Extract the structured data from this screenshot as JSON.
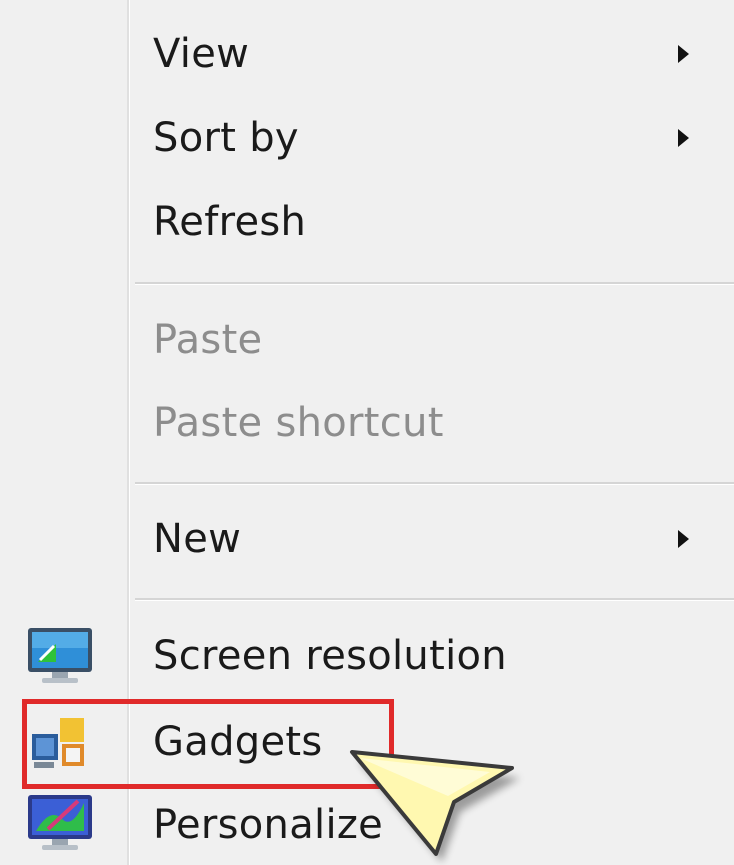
{
  "context_menu": {
    "items": [
      {
        "label": "View",
        "has_submenu": true,
        "enabled": true
      },
      {
        "label": "Sort by",
        "has_submenu": true,
        "enabled": true
      },
      {
        "label": "Refresh",
        "has_submenu": false,
        "enabled": true
      },
      {
        "label": "Paste",
        "has_submenu": false,
        "enabled": false
      },
      {
        "label": "Paste shortcut",
        "has_submenu": false,
        "enabled": false
      },
      {
        "label": "New",
        "has_submenu": true,
        "enabled": true
      },
      {
        "label": "Screen resolution",
        "has_submenu": false,
        "enabled": true,
        "icon": "screen-resolution-icon"
      },
      {
        "label": "Gadgets",
        "has_submenu": false,
        "enabled": true,
        "icon": "gadgets-icon",
        "highlighted": true
      },
      {
        "label": "Personalize",
        "has_submenu": false,
        "enabled": true,
        "icon": "personalize-icon"
      }
    ]
  },
  "colors": {
    "menu_background": "#f0f0f0",
    "text": "#1a1a1a",
    "disabled_text": "#8d8d8d",
    "highlight_box": "#e02a2a",
    "cursor_fill": "#fff8b0"
  }
}
